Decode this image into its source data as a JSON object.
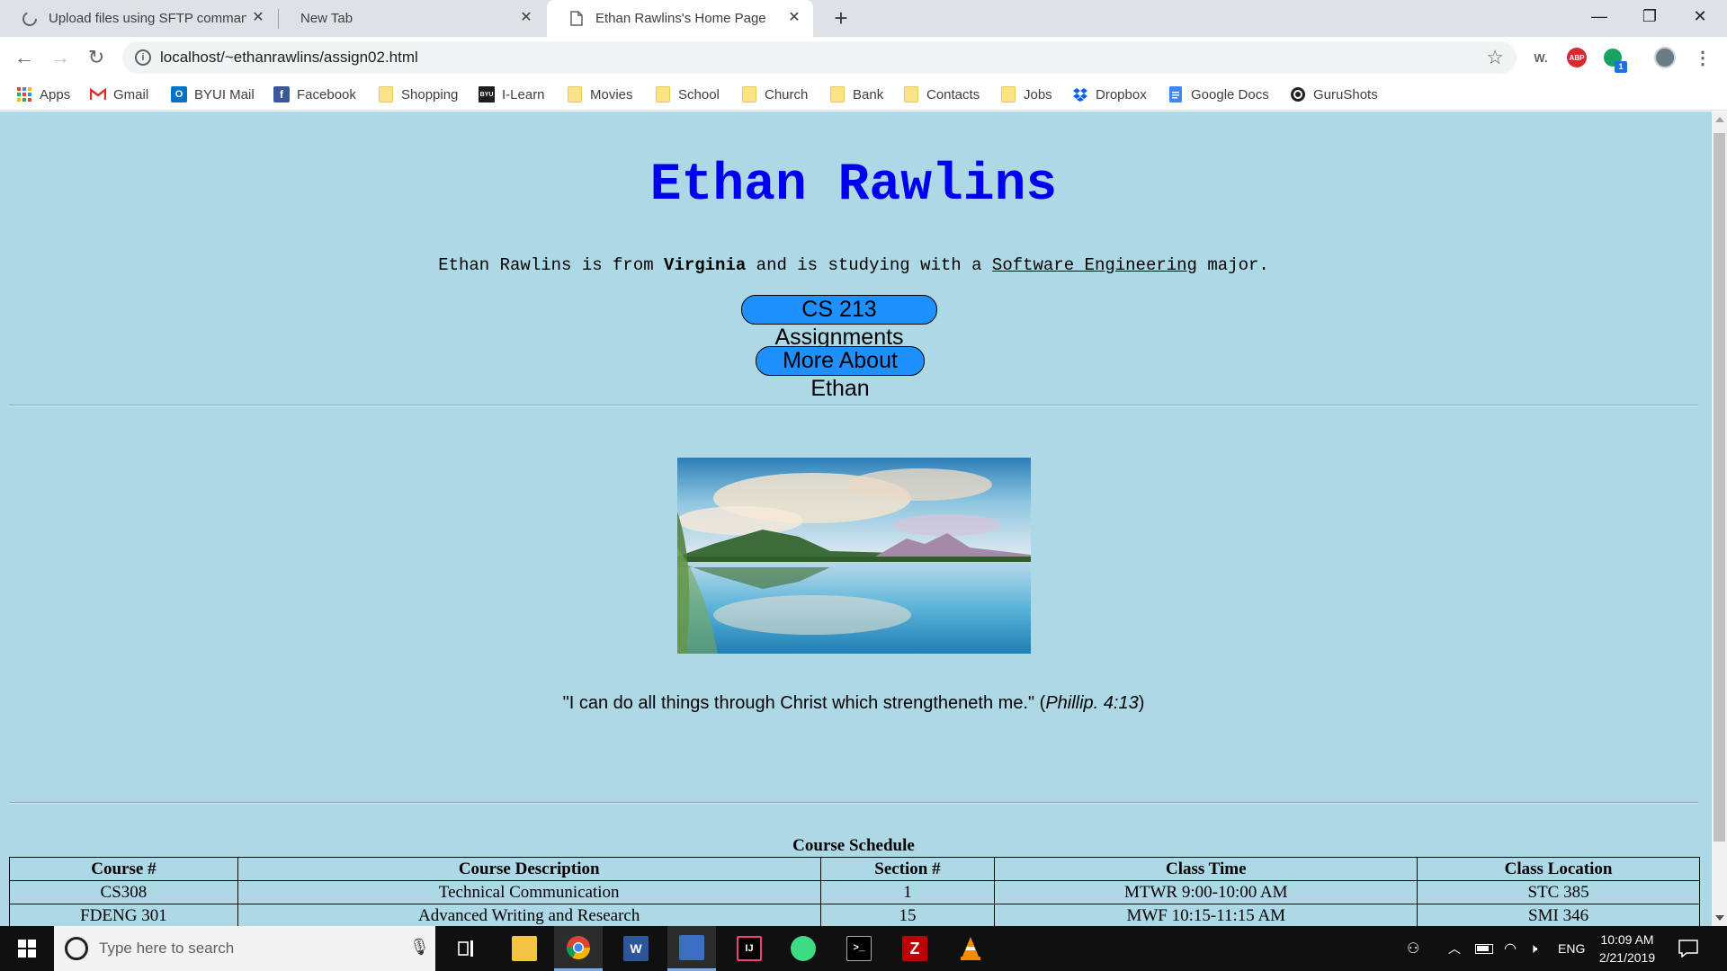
{
  "browser": {
    "tabs": [
      {
        "title": "Upload files using SFTP comman",
        "active": false
      },
      {
        "title": "New Tab",
        "active": false
      },
      {
        "title": "Ethan Rawlins's Home Page",
        "active": true
      }
    ],
    "url": "localhost/~ethanrawlins/assign02.html",
    "extensions": {
      "w_label": "W.",
      "abp_label": "ABP",
      "badge_count": "1"
    },
    "bookmarks": [
      {
        "label": "Apps",
        "icon": "apps-grid-icon"
      },
      {
        "label": "Gmail",
        "icon": "gmail-icon"
      },
      {
        "label": "BYUI Mail",
        "icon": "outlook-icon"
      },
      {
        "label": "Facebook",
        "icon": "facebook-icon"
      },
      {
        "label": "Shopping",
        "icon": "folder-icon"
      },
      {
        "label": "I-Learn",
        "icon": "byu-icon"
      },
      {
        "label": "Movies",
        "icon": "folder-icon"
      },
      {
        "label": "School",
        "icon": "folder-icon"
      },
      {
        "label": "Church",
        "icon": "folder-icon"
      },
      {
        "label": "Bank",
        "icon": "folder-icon"
      },
      {
        "label": "Contacts",
        "icon": "folder-icon"
      },
      {
        "label": "Jobs",
        "icon": "folder-icon"
      },
      {
        "label": "Dropbox",
        "icon": "dropbox-icon"
      },
      {
        "label": "Google Docs",
        "icon": "google-docs-icon"
      },
      {
        "label": "GuruShots",
        "icon": "gurushots-icon"
      }
    ],
    "byu_icon_text": "BYU"
  },
  "page": {
    "heading": "Ethan Rawlins",
    "intro": {
      "before": "Ethan Rawlins is from ",
      "state": "Virginia",
      "middle": " and is studying with a ",
      "major": "Software Engineering",
      "after": " major."
    },
    "buttons": {
      "assignments": "CS 213 Assignments",
      "about": "More About Ethan"
    },
    "quote": {
      "text": "\"I can do all things through Christ which strengtheneth me.\" (",
      "reference": "Phillip. 4:13",
      "close": ")"
    },
    "schedule": {
      "caption": "Course Schedule",
      "headers": [
        "Course #",
        "Course Description",
        "Section #",
        "Class Time",
        "Class Location"
      ],
      "rows": [
        [
          "CS308",
          "Technical Communication",
          "1",
          "MTWR 9:00-10:00 AM",
          "STC 385"
        ],
        [
          "FDENG 301",
          "Advanced Writing and Research",
          "15",
          "MWF 10:15-11:15 AM",
          "SMI 346"
        ]
      ]
    }
  },
  "taskbar": {
    "search_placeholder": "Type here to search",
    "language": "ENG",
    "time": "10:09 AM",
    "date": "2/21/2019",
    "apps": [
      "task-view-icon",
      "file-explorer-icon",
      "chrome-icon",
      "word-icon",
      "remote-desktop-icon",
      "intellij-icon",
      "android-studio-icon",
      "terminal-icon",
      "filezilla-icon",
      "vlc-icon"
    ],
    "word_label": "W",
    "intellij_label": "IJ",
    "terminal_label": ">_",
    "filezilla_label": "Z"
  },
  "colors": {
    "page_background": "#add8e6",
    "heading": "#0000ee",
    "pill_button": "#1e90ff",
    "tabstrip": "#dee1e6",
    "taskbar": "#101010"
  }
}
